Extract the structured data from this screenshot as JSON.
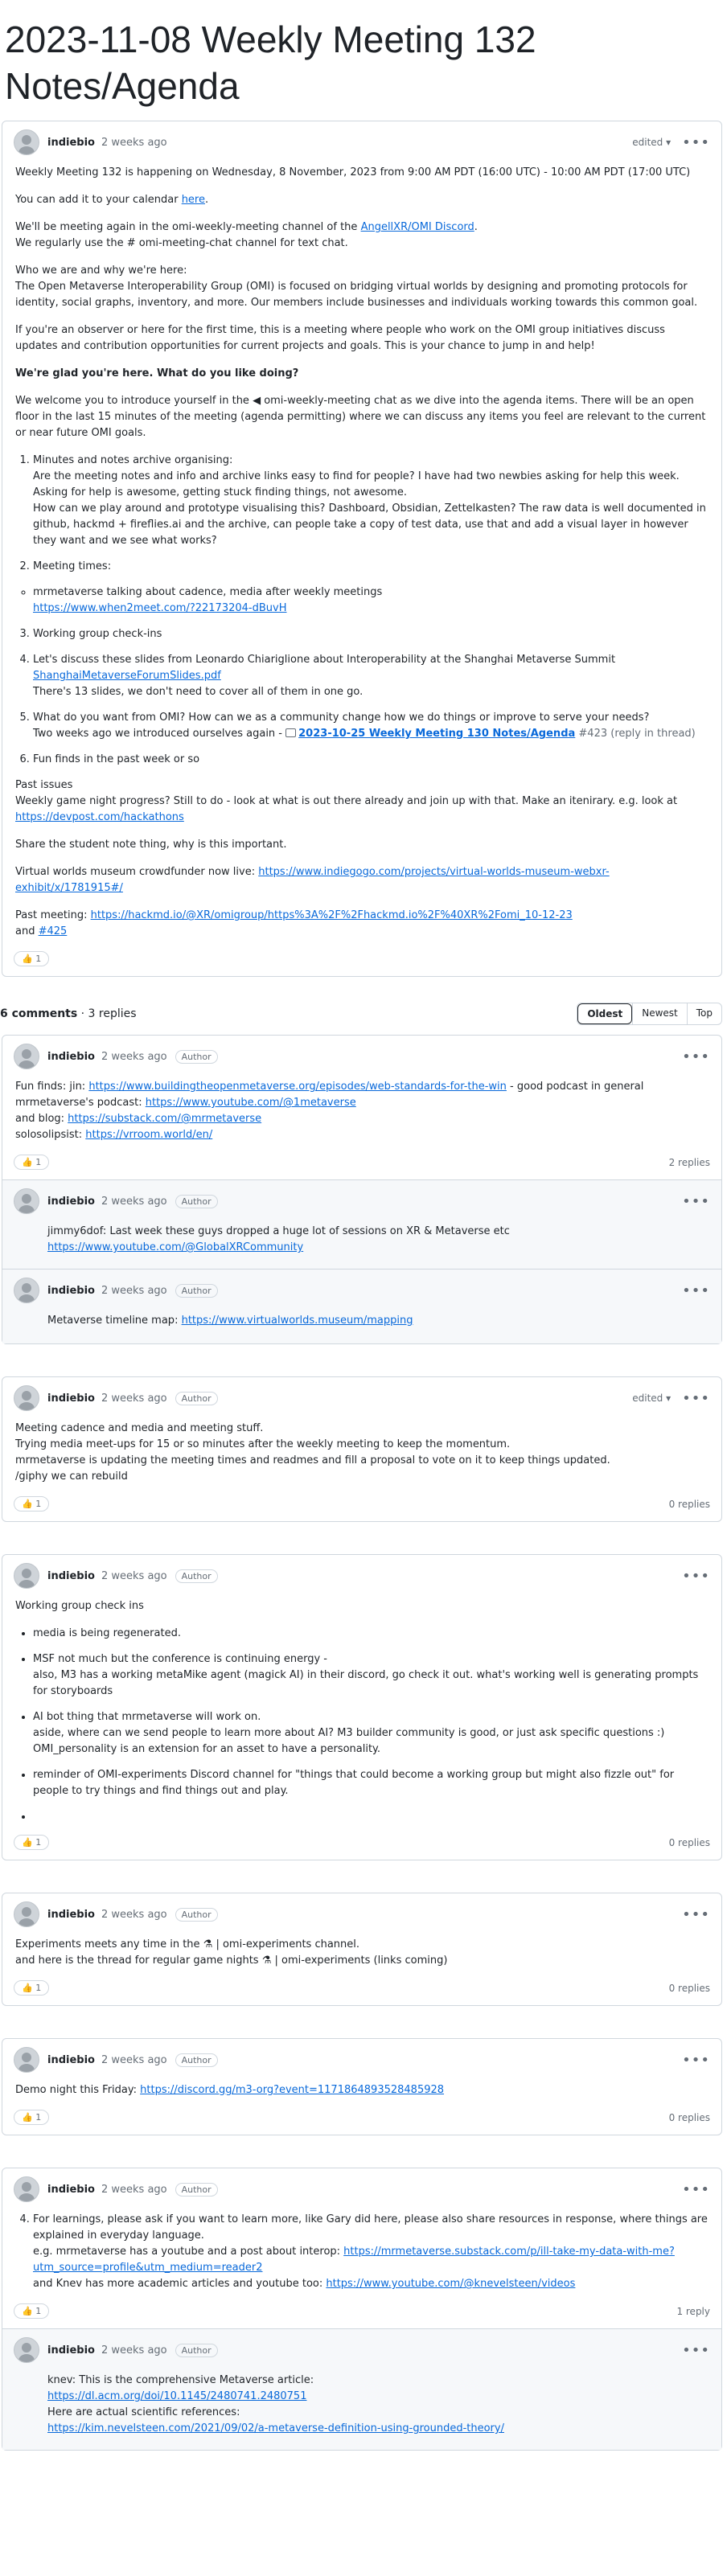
{
  "title": "2023-11-08 Weekly Meeting 132 Notes/Agenda",
  "post": {
    "author": "indiebio",
    "time": "2 weeks ago",
    "edited": "edited ▾",
    "p1": "Weekly Meeting 132 is happening on Wednesday, 8 November, 2023 from 9:00 AM PDT (16:00 UTC) - 10:00 AM PDT (17:00 UTC)",
    "p2a": "You can add it to your calendar ",
    "p2link": "here",
    "p3a": "We'll be meeting again in the omi-weekly-meeting channel of the ",
    "p3link": "AngellXR/OMI Discord",
    "p3b": "We regularly use the # omi-meeting-chat channel for text chat.",
    "p4a": "Who we are and why we're here:",
    "p4b": "The Open Metaverse Interoperability Group (OMI) is focused on bridging virtual worlds by designing and promoting protocols for identity, social graphs, inventory, and more. Our members include businesses and individuals working towards this common goal.",
    "p5": "If you're an observer or here for the first time, this is a meeting where people who work on the OMI group initiatives discuss updates and contribution opportunities for current projects and goals. This is your chance to jump in and help!",
    "p6": "We're glad you're here. What do you like doing?",
    "p7": "We welcome you to introduce yourself in the ◀ omi-weekly-meeting chat as we dive into the agenda items. There will be an open floor in the last 15 minutes of the meeting (agenda permitting) where we can discuss any items you feel are relevant to the current or near future OMI goals.",
    "item1a": "Minutes and notes archive organising:",
    "item1b": "Are the meeting notes and info and archive links easy to find for people? I have had two newbies asking for help this week. Asking for help is awesome, getting stuck finding things, not awesome.",
    "item1c": "How can we play around and prototype visualising this? Dashboard, Obsidian, Zettelkasten? The raw data is well documented in github, hackmd + fireflies.ai and the archive, can people take a copy of test data, use that and add a visual layer in however they want and we see what works?",
    "item2": "Meeting times:",
    "bullet1": "mrmetaverse talking about cadence, media after weekly meetings",
    "bullet1link": "https://www.when2meet.com/?22173204-dBuvH",
    "item3": "Working group check-ins",
    "item4a": "Let's discuss these slides from Leonardo Chiariglione about Interoperability at the Shanghai Metaverse Summit",
    "item4link": "ShanghaiMetaverseForumSlides.pdf",
    "item4b": "There's 13 slides, we don't need to cover all of them in one go.",
    "item5a": "What do you want from OMI? How can we as a community change how we do things or improve to serve your needs?",
    "item5b": "Two weeks ago we introduced ourselves again - ",
    "item5link": "2023-10-25 Weekly Meeting 130 Notes/Agenda",
    "item5c": " #423 (reply in thread)",
    "item6": "Fun finds in the past week or so",
    "past1": "Past issues",
    "past2": "Weekly game night progress? Still to do - look at what is out there already and join up with that. Make an itenirary. e.g. look at",
    "past2link": "https://devpost.com/hackathons",
    "p8": "Share the student note thing, why is this important.",
    "p9a": "Virtual worlds museum crowdfunder now live: ",
    "p9link": "https://www.indiegogo.com/projects/virtual-worlds-museum-webxr-exhibit/x/1781915#/",
    "p10a": "Past meeting: ",
    "p10link": "https://hackmd.io/@XR/omigroup/https%3A%2F%2Fhackmd.io%2F%40XR%2Fomi_10-12-23",
    "p10b": "and ",
    "p10link2": "#425",
    "reactions": "👍 1"
  },
  "comments_bar": {
    "count": "6 comments",
    "replies": " · 3 replies",
    "sort": [
      "Oldest",
      "Newest",
      "Top"
    ]
  },
  "comments": {
    "c1": {
      "author": "indiebio",
      "time": "2 weeks ago",
      "badge": "Author",
      "l1a": "Fun finds: jin: ",
      "l1link": "https://www.buildingtheopenmetaverse.org/episodes/web-standards-for-the-win",
      "l1b": " - good podcast in general",
      "l2a": "mrmetaverse's podcast: ",
      "l2link": "https://www.youtube.com/@1metaverse",
      "l3a": "and blog: ",
      "l3link": "https://substack.com/@mrmetaverse",
      "l4a": "solosolipsist: ",
      "l4link": "https://vrroom.world/en/",
      "reactions": "👍 1",
      "replies": "2 replies",
      "r1": {
        "author": "indiebio",
        "time": "2 weeks ago",
        "badge": "Author",
        "text": "jimmy6dof: Last week these guys dropped a huge lot of sessions on XR & Metaverse etc",
        "link": "https://www.youtube.com/@GlobalXRCommunity"
      },
      "r2": {
        "author": "indiebio",
        "time": "2 weeks ago",
        "badge": "Author",
        "texta": "Metaverse timeline map: ",
        "link": "https://www.virtualworlds.museum/mapping"
      }
    },
    "c2": {
      "author": "indiebio",
      "time": "2 weeks ago",
      "badge": "Author",
      "edited": "edited ▾",
      "l1": "Meeting cadence and media and meeting stuff.",
      "l2": "Trying media meet-ups for 15 or so minutes after the weekly meeting to keep the momentum.",
      "l3": "mrmetaverse is updating the meeting times and readmes and fill a proposal to vote on it to keep things updated.",
      "l4": "/giphy we can rebuild",
      "reactions": "👍 1",
      "replies": "0 replies"
    },
    "c3": {
      "author": "indiebio",
      "time": "2 weeks ago",
      "badge": "Author",
      "title": "Working group check ins",
      "b1": "media is being regenerated.",
      "b2a": "MSF not much but the conference is continuing energy -",
      "b2b": "also, M3 has a working metaMike agent (magick AI) in their discord, go check it out. what's working well is generating prompts for storyboards",
      "b3a": "AI bot thing that mrmetaverse will work on.",
      "b3b": "aside, where can we send people to learn more about AI? M3 builder community is good, or just ask specific questions :)",
      "b3c": "OMI_personality is an extension for an asset to have a personality.",
      "b4": "reminder of OMI-experiments Discord channel for \"things that could become a working group but might also fizzle out\" for people to try things and find things out and play.",
      "reactions": "👍 1",
      "replies": "0 replies"
    },
    "c4": {
      "author": "indiebio",
      "time": "2 weeks ago",
      "badge": "Author",
      "l1": "Experiments meets any time in the ⚗ | omi-experiments channel.",
      "l2": "and here is the thread for regular game nights ⚗ | omi-experiments (links coming)",
      "reactions": "👍 1",
      "replies": "0 replies"
    },
    "c5": {
      "author": "indiebio",
      "time": "2 weeks ago",
      "badge": "Author",
      "l1a": "Demo night this Friday: ",
      "l1link": "https://discord.gg/m3-org?event=1171864893528485928",
      "reactions": "👍 1",
      "replies": "0 replies"
    },
    "c6": {
      "author": "indiebio",
      "time": "2 weeks ago",
      "badge": "Author",
      "l1": "For learnings, please ask if you want to learn more, like Gary did here, please also share resources in response, where things are explained in everyday language.",
      "l2a": "e.g. mrmetaverse has a youtube and a post about interop: ",
      "l2link": "https://mrmetaverse.substack.com/p/ill-take-my-data-with-me?utm_source=profile&utm_medium=reader2",
      "l3a": "and Knev has more academic articles and youtube too: ",
      "l3link": "https://www.youtube.com/@knevelsteen/videos",
      "reactions": "👍 1",
      "replies": "1 reply",
      "r1": {
        "author": "indiebio",
        "time": "2 weeks ago",
        "badge": "Author",
        "l1": "knev: This is the comprehensive Metaverse article:",
        "l1link": "https://dl.acm.org/doi/10.1145/2480741.2480751",
        "l2": "Here are actual scientific references:",
        "l2link": "https://kim.nevelsteen.com/2021/09/02/a-metaverse-definition-using-grounded-theory/"
      }
    }
  }
}
